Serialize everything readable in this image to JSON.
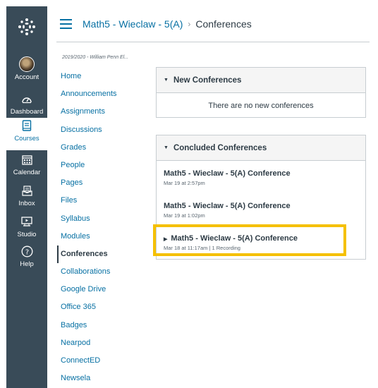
{
  "global_nav": {
    "items": [
      {
        "label": "Account",
        "icon": "account-avatar"
      },
      {
        "label": "Dashboard",
        "icon": "dashboard-icon"
      },
      {
        "label": "Courses",
        "icon": "courses-icon"
      },
      {
        "label": "Calendar",
        "icon": "calendar-icon"
      },
      {
        "label": "Inbox",
        "icon": "inbox-icon"
      },
      {
        "label": "Studio",
        "icon": "studio-icon"
      },
      {
        "label": "Help",
        "icon": "help-icon"
      }
    ],
    "active": "Courses",
    "background": "#394b58"
  },
  "breadcrumb": {
    "course": "Math5 - Wieclaw - 5(A)",
    "separator": "›",
    "current": "Conferences"
  },
  "course_nav": {
    "term": "2019/2020 - William Penn El...",
    "items": [
      "Home",
      "Announcements",
      "Assignments",
      "Discussions",
      "Grades",
      "People",
      "Pages",
      "Files",
      "Syllabus",
      "Modules",
      "Conferences",
      "Collaborations",
      "Google Drive",
      "Office 365",
      "Badges",
      "Nearpod",
      "ConnectED",
      "Newsela"
    ],
    "active": "Conferences"
  },
  "new_conferences": {
    "title": "New Conferences",
    "empty_text": "There are no new conferences"
  },
  "concluded_conferences": {
    "title": "Concluded Conferences",
    "items": [
      {
        "title": "Math5 - Wieclaw - 5(A) Conference",
        "meta": "Mar 19 at 2:57pm"
      },
      {
        "title": "Math5 - Wieclaw - 5(A) Conference",
        "meta": "Mar 19 at 1:02pm"
      },
      {
        "title": "Math5 - Wieclaw - 5(A) Conference",
        "meta": "Mar 18 at 11:17am  |  1 Recording"
      }
    ]
  },
  "colors": {
    "link": "#0770a3",
    "highlight": "#f5c000",
    "text": "#2d3b45"
  }
}
